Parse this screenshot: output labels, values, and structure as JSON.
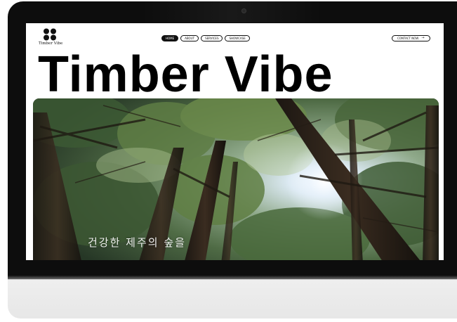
{
  "brand": {
    "logo_text": "Timber Vibe",
    "logo_icon": "four-dots-logo-icon"
  },
  "nav": {
    "items": [
      {
        "label": "HOME",
        "active": true
      },
      {
        "label": "ABOUT",
        "active": false
      },
      {
        "label": "SERVICES",
        "active": false
      },
      {
        "label": "SHOWCASE",
        "active": false
      }
    ],
    "contact_label": "CONTACT NOW",
    "contact_icon": "arrow-right-icon"
  },
  "hero": {
    "title": "Timber Vibe",
    "caption": "건강한 제주의 숲을"
  },
  "colors": {
    "frame": "#0d0d0d",
    "chin": "#ececec",
    "text": "#000000",
    "active_pill": "#111111"
  }
}
